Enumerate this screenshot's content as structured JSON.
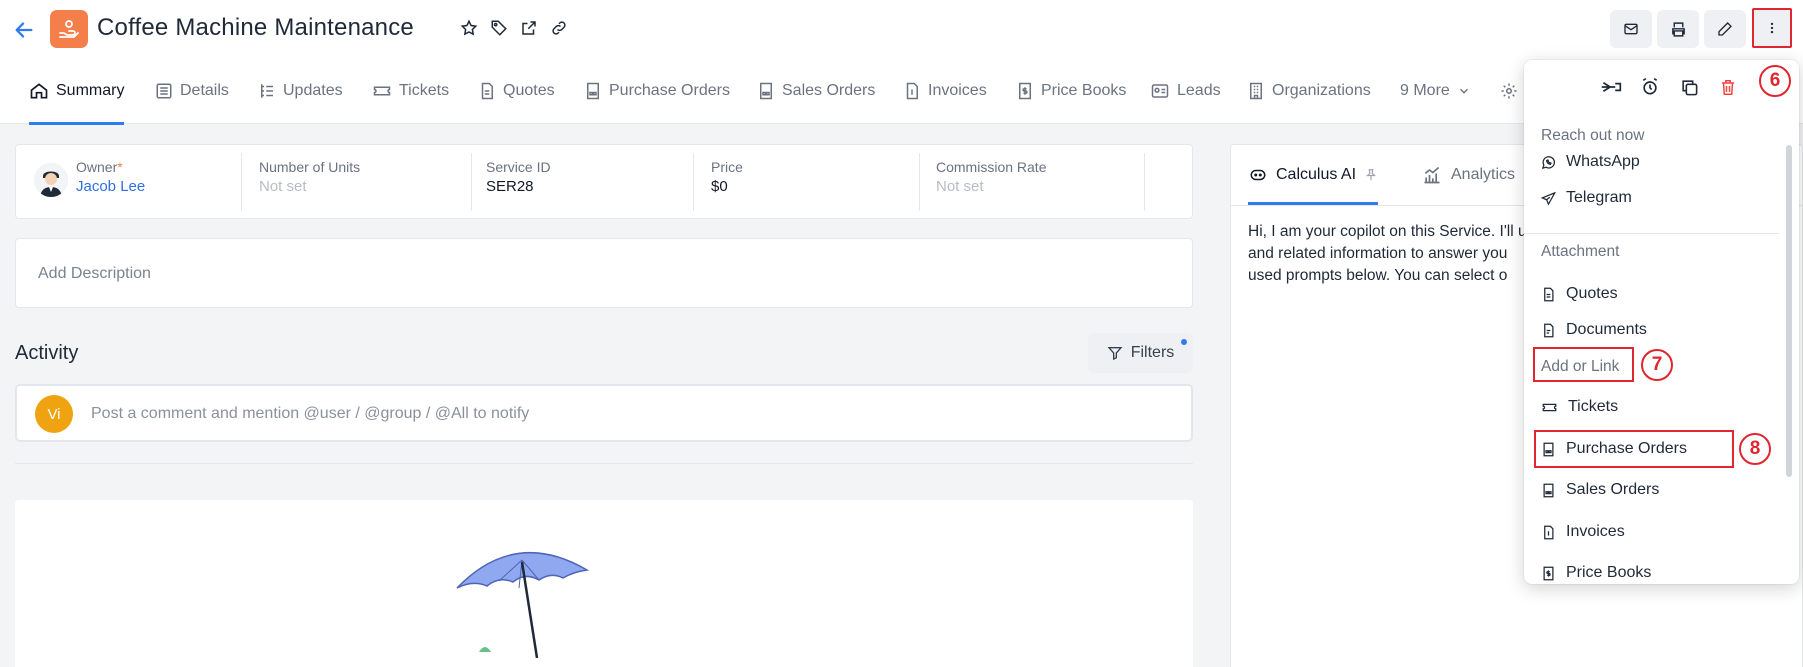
{
  "header": {
    "title": "Coffee Machine Maintenance",
    "actions": [
      "star-icon",
      "tag-icon",
      "open-external-icon",
      "link-icon"
    ],
    "right_buttons": [
      "mail-icon",
      "print-icon",
      "edit-icon",
      "more-vertical-icon"
    ]
  },
  "tabs": [
    {
      "label": "Summary",
      "icon": "home-icon",
      "active": true
    },
    {
      "label": "Details",
      "icon": "list-icon"
    },
    {
      "label": "Updates",
      "icon": "updates-icon"
    },
    {
      "label": "Tickets",
      "icon": "ticket-icon"
    },
    {
      "label": "Quotes",
      "icon": "quote-icon"
    },
    {
      "label": "Purchase Orders",
      "icon": "purchase-order-icon"
    },
    {
      "label": "Sales Orders",
      "icon": "sales-order-icon"
    },
    {
      "label": "Invoices",
      "icon": "invoice-icon"
    },
    {
      "label": "Price Books",
      "icon": "price-book-icon"
    },
    {
      "label": "Leads",
      "icon": "lead-icon"
    },
    {
      "label": "Organizations",
      "icon": "organization-icon"
    },
    {
      "label": "9 More",
      "icon": "chevron-down-icon"
    }
  ],
  "fields": {
    "owner": {
      "label": "Owner",
      "required_mark": "*",
      "value": "Jacob Lee"
    },
    "units": {
      "label": "Number of Units",
      "value": "Not set"
    },
    "service_id": {
      "label": "Service ID",
      "value": "SER28"
    },
    "price": {
      "label": "Price",
      "value": "$0"
    },
    "commission": {
      "label": "Commission Rate",
      "value": "Not set"
    }
  },
  "description": {
    "placeholder": "Add Description"
  },
  "activity": {
    "title": "Activity",
    "filters_label": "Filters",
    "comment_avatar": "Vi",
    "comment_placeholder": "Post a comment and mention @user / @group / @All to notify"
  },
  "ai_panel": {
    "tabs": [
      {
        "label": "Calculus AI",
        "icon": "ai-bot-icon",
        "active": true
      },
      {
        "label": "Analytics",
        "icon": "analytics-icon"
      }
    ],
    "message_lines": [
      "Hi, I am your copilot on this Service. I'll u",
      "and related information to answer you",
      "used prompts below. You can select o"
    ]
  },
  "menu": {
    "top_icons": [
      "unfollow-icon",
      "alarm-icon",
      "duplicate-icon",
      "delete-icon"
    ],
    "section_reach": "Reach out now",
    "reach_items": [
      {
        "label": "WhatsApp",
        "icon": "whatsapp-icon"
      },
      {
        "label": "Telegram",
        "icon": "telegram-icon"
      }
    ],
    "section_attachment": "Attachment",
    "attachment_items": [
      {
        "label": "Quotes",
        "icon": "quote-icon"
      },
      {
        "label": "Documents",
        "icon": "document-icon"
      }
    ],
    "section_link": "Add or Link",
    "link_items": [
      {
        "label": "Tickets",
        "icon": "ticket-icon"
      },
      {
        "label": "Purchase Orders",
        "icon": "purchase-order-icon"
      },
      {
        "label": "Sales Orders",
        "icon": "sales-order-icon"
      },
      {
        "label": "Invoices",
        "icon": "invoice-icon"
      },
      {
        "label": "Price Books",
        "icon": "price-book-icon"
      }
    ]
  },
  "annotations": {
    "n6": "6",
    "n7": "7",
    "n8": "8"
  },
  "colors": {
    "accent": "#2f7bf0",
    "module": "#f47f4a",
    "annotation": "#e0262f",
    "avatar": "#f0a310"
  }
}
